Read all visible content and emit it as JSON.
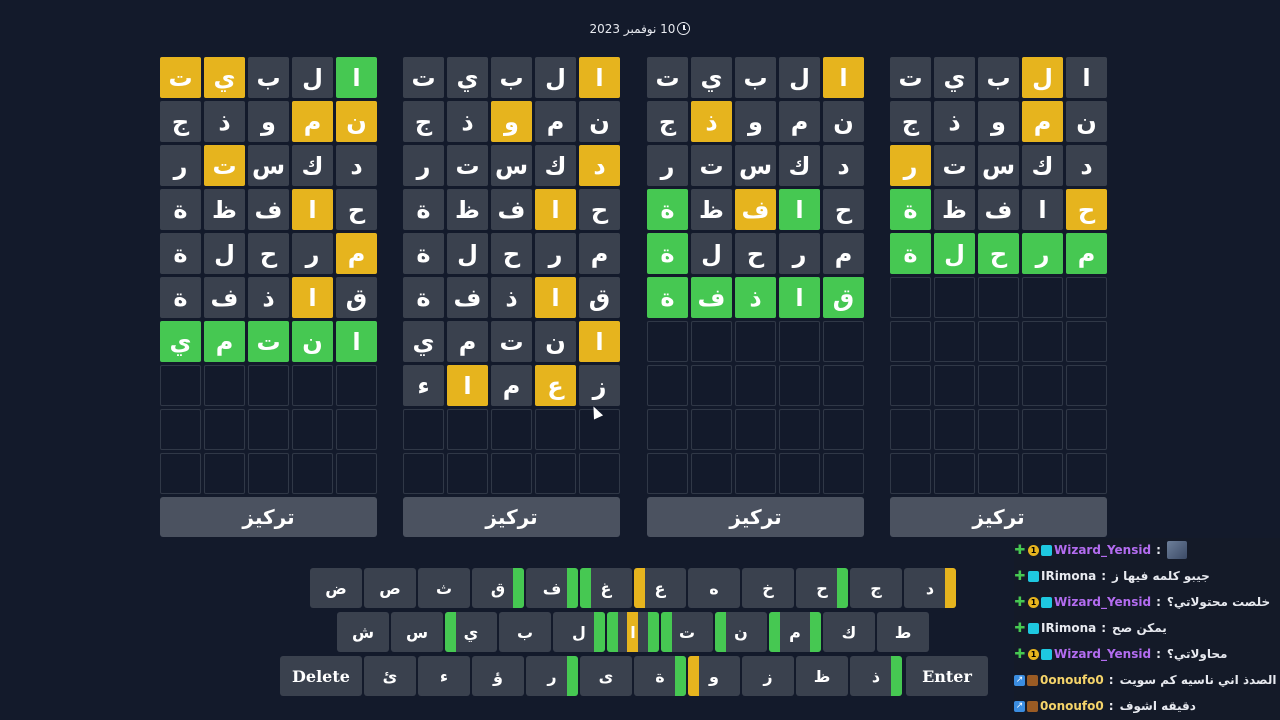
{
  "header": {
    "date": "10 نوفمبر 2023"
  },
  "boards": [
    {
      "focus_label": "تركيز",
      "rows": [
        [
          [
            "ت",
            "y"
          ],
          [
            "ي",
            "y"
          ],
          [
            "ب",
            "n"
          ],
          [
            "ل",
            "n"
          ],
          [
            "ا",
            "g"
          ]
        ],
        [
          [
            "ج",
            "n"
          ],
          [
            "ذ",
            "n"
          ],
          [
            "و",
            "n"
          ],
          [
            "م",
            "y"
          ],
          [
            "ن",
            "y"
          ]
        ],
        [
          [
            "ر",
            "n"
          ],
          [
            "ت",
            "y"
          ],
          [
            "س",
            "n"
          ],
          [
            "ك",
            "n"
          ],
          [
            "د",
            "n"
          ]
        ],
        [
          [
            "ة",
            "n"
          ],
          [
            "ظ",
            "n"
          ],
          [
            "ف",
            "n"
          ],
          [
            "ا",
            "y"
          ],
          [
            "ح",
            "n"
          ]
        ],
        [
          [
            "ة",
            "n"
          ],
          [
            "ل",
            "n"
          ],
          [
            "ح",
            "n"
          ],
          [
            "ر",
            "n"
          ],
          [
            "م",
            "y"
          ]
        ],
        [
          [
            "ة",
            "n"
          ],
          [
            "ف",
            "n"
          ],
          [
            "ذ",
            "n"
          ],
          [
            "ا",
            "y"
          ],
          [
            "ق",
            "n"
          ]
        ],
        [
          [
            "ي",
            "g"
          ],
          [
            "م",
            "g"
          ],
          [
            "ت",
            "g"
          ],
          [
            "ن",
            "g"
          ],
          [
            "ا",
            "g"
          ]
        ],
        [
          [
            "",
            "e"
          ],
          [
            "",
            "e"
          ],
          [
            "",
            "e"
          ],
          [
            "",
            "e"
          ],
          [
            "",
            "e"
          ]
        ],
        [
          [
            "",
            "e"
          ],
          [
            "",
            "e"
          ],
          [
            "",
            "e"
          ],
          [
            "",
            "e"
          ],
          [
            "",
            "e"
          ]
        ],
        [
          [
            "",
            "e"
          ],
          [
            "",
            "e"
          ],
          [
            "",
            "e"
          ],
          [
            "",
            "e"
          ],
          [
            "",
            "e"
          ]
        ]
      ]
    },
    {
      "focus_label": "تركيز",
      "rows": [
        [
          [
            "ت",
            "n"
          ],
          [
            "ي",
            "n"
          ],
          [
            "ب",
            "n"
          ],
          [
            "ل",
            "n"
          ],
          [
            "ا",
            "y"
          ]
        ],
        [
          [
            "ج",
            "n"
          ],
          [
            "ذ",
            "n"
          ],
          [
            "و",
            "y"
          ],
          [
            "م",
            "n"
          ],
          [
            "ن",
            "n"
          ]
        ],
        [
          [
            "ر",
            "n"
          ],
          [
            "ت",
            "n"
          ],
          [
            "س",
            "n"
          ],
          [
            "ك",
            "n"
          ],
          [
            "د",
            "y"
          ]
        ],
        [
          [
            "ة",
            "n"
          ],
          [
            "ظ",
            "n"
          ],
          [
            "ف",
            "n"
          ],
          [
            "ا",
            "y"
          ],
          [
            "ح",
            "n"
          ]
        ],
        [
          [
            "ة",
            "n"
          ],
          [
            "ل",
            "n"
          ],
          [
            "ح",
            "n"
          ],
          [
            "ر",
            "n"
          ],
          [
            "م",
            "n"
          ]
        ],
        [
          [
            "ة",
            "n"
          ],
          [
            "ف",
            "n"
          ],
          [
            "ذ",
            "n"
          ],
          [
            "ا",
            "y"
          ],
          [
            "ق",
            "n"
          ]
        ],
        [
          [
            "ي",
            "n"
          ],
          [
            "م",
            "n"
          ],
          [
            "ت",
            "n"
          ],
          [
            "ن",
            "n"
          ],
          [
            "ا",
            "y"
          ]
        ],
        [
          [
            "ء",
            "n"
          ],
          [
            "ا",
            "y"
          ],
          [
            "م",
            "n"
          ],
          [
            "ع",
            "y"
          ],
          [
            "ز",
            "n"
          ]
        ],
        [
          [
            "",
            "e"
          ],
          [
            "",
            "e"
          ],
          [
            "",
            "e"
          ],
          [
            "",
            "e"
          ],
          [
            "",
            "e"
          ]
        ],
        [
          [
            "",
            "e"
          ],
          [
            "",
            "e"
          ],
          [
            "",
            "e"
          ],
          [
            "",
            "e"
          ],
          [
            "",
            "e"
          ]
        ]
      ]
    },
    {
      "focus_label": "تركيز",
      "rows": [
        [
          [
            "ت",
            "n"
          ],
          [
            "ي",
            "n"
          ],
          [
            "ب",
            "n"
          ],
          [
            "ل",
            "n"
          ],
          [
            "ا",
            "y"
          ]
        ],
        [
          [
            "ج",
            "n"
          ],
          [
            "ذ",
            "y"
          ],
          [
            "و",
            "n"
          ],
          [
            "م",
            "n"
          ],
          [
            "ن",
            "n"
          ]
        ],
        [
          [
            "ر",
            "n"
          ],
          [
            "ت",
            "n"
          ],
          [
            "س",
            "n"
          ],
          [
            "ك",
            "n"
          ],
          [
            "د",
            "n"
          ]
        ],
        [
          [
            "ة",
            "g"
          ],
          [
            "ظ",
            "n"
          ],
          [
            "ف",
            "y"
          ],
          [
            "ا",
            "g"
          ],
          [
            "ح",
            "n"
          ]
        ],
        [
          [
            "ة",
            "g"
          ],
          [
            "ل",
            "n"
          ],
          [
            "ح",
            "n"
          ],
          [
            "ر",
            "n"
          ],
          [
            "م",
            "n"
          ]
        ],
        [
          [
            "ة",
            "g"
          ],
          [
            "ف",
            "g"
          ],
          [
            "ذ",
            "g"
          ],
          [
            "ا",
            "g"
          ],
          [
            "ق",
            "g"
          ]
        ],
        [
          [
            "",
            "e"
          ],
          [
            "",
            "e"
          ],
          [
            "",
            "e"
          ],
          [
            "",
            "e"
          ],
          [
            "",
            "e"
          ]
        ],
        [
          [
            "",
            "e"
          ],
          [
            "",
            "e"
          ],
          [
            "",
            "e"
          ],
          [
            "",
            "e"
          ],
          [
            "",
            "e"
          ]
        ],
        [
          [
            "",
            "e"
          ],
          [
            "",
            "e"
          ],
          [
            "",
            "e"
          ],
          [
            "",
            "e"
          ],
          [
            "",
            "e"
          ]
        ],
        [
          [
            "",
            "e"
          ],
          [
            "",
            "e"
          ],
          [
            "",
            "e"
          ],
          [
            "",
            "e"
          ],
          [
            "",
            "e"
          ]
        ]
      ]
    },
    {
      "focus_label": "تركيز",
      "rows": [
        [
          [
            "ت",
            "n"
          ],
          [
            "ي",
            "n"
          ],
          [
            "ب",
            "n"
          ],
          [
            "ل",
            "y"
          ],
          [
            "ا",
            "n"
          ]
        ],
        [
          [
            "ج",
            "n"
          ],
          [
            "ذ",
            "n"
          ],
          [
            "و",
            "n"
          ],
          [
            "م",
            "y"
          ],
          [
            "ن",
            "n"
          ]
        ],
        [
          [
            "ر",
            "y"
          ],
          [
            "ت",
            "n"
          ],
          [
            "س",
            "n"
          ],
          [
            "ك",
            "n"
          ],
          [
            "د",
            "n"
          ]
        ],
        [
          [
            "ة",
            "g"
          ],
          [
            "ظ",
            "n"
          ],
          [
            "ف",
            "n"
          ],
          [
            "ا",
            "n"
          ],
          [
            "ح",
            "y"
          ]
        ],
        [
          [
            "ة",
            "g"
          ],
          [
            "ل",
            "g"
          ],
          [
            "ح",
            "g"
          ],
          [
            "ر",
            "g"
          ],
          [
            "م",
            "g"
          ]
        ],
        [
          [
            "",
            "e"
          ],
          [
            "",
            "e"
          ],
          [
            "",
            "e"
          ],
          [
            "",
            "e"
          ],
          [
            "",
            "e"
          ]
        ],
        [
          [
            "",
            "e"
          ],
          [
            "",
            "e"
          ],
          [
            "",
            "e"
          ],
          [
            "",
            "e"
          ],
          [
            "",
            "e"
          ]
        ],
        [
          [
            "",
            "e"
          ],
          [
            "",
            "e"
          ],
          [
            "",
            "e"
          ],
          [
            "",
            "e"
          ],
          [
            "",
            "e"
          ]
        ],
        [
          [
            "",
            "e"
          ],
          [
            "",
            "e"
          ],
          [
            "",
            "e"
          ],
          [
            "",
            "e"
          ],
          [
            "",
            "e"
          ]
        ],
        [
          [
            "",
            "e"
          ],
          [
            "",
            "e"
          ],
          [
            "",
            "e"
          ],
          [
            "",
            "e"
          ],
          [
            "",
            "e"
          ]
        ]
      ]
    }
  ],
  "keyboard": {
    "rows": [
      [
        {
          "k": "ض"
        },
        {
          "k": "ص"
        },
        {
          "k": "ث"
        },
        {
          "k": "ق",
          "bars": [
            [
              "right",
              "g"
            ]
          ]
        },
        {
          "k": "ف",
          "bars": [
            [
              "right",
              "g"
            ]
          ]
        },
        {
          "k": "غ",
          "bars": [
            [
              "left",
              "g"
            ]
          ]
        },
        {
          "k": "ع",
          "bars": [
            [
              "left",
              "y"
            ]
          ]
        },
        {
          "k": "ه"
        },
        {
          "k": "خ"
        },
        {
          "k": "ح",
          "bars": [
            [
              "right",
              "g"
            ]
          ]
        },
        {
          "k": "ج"
        },
        {
          "k": "د",
          "bars": [
            [
              "right",
              "y"
            ]
          ]
        }
      ],
      [
        {
          "k": "ش"
        },
        {
          "k": "س"
        },
        {
          "k": "ي",
          "bars": [
            [
              "left",
              "g"
            ]
          ]
        },
        {
          "k": "ب"
        },
        {
          "k": "ل",
          "bars": [
            [
              "right",
              "g"
            ]
          ]
        },
        {
          "k": "ا",
          "bars": [
            [
              "left",
              "g"
            ],
            [
              "mid",
              "y"
            ],
            [
              "right",
              "g"
            ]
          ]
        },
        {
          "k": "ت",
          "bars": [
            [
              "left",
              "g"
            ]
          ]
        },
        {
          "k": "ن",
          "bars": [
            [
              "left",
              "g"
            ]
          ]
        },
        {
          "k": "م",
          "bars": [
            [
              "left",
              "g"
            ],
            [
              "right",
              "g"
            ]
          ]
        },
        {
          "k": "ك"
        },
        {
          "k": "ط"
        }
      ],
      [
        {
          "k": "Delete",
          "wide": true
        },
        {
          "k": "ئ"
        },
        {
          "k": "ء"
        },
        {
          "k": "ؤ"
        },
        {
          "k": "ر",
          "bars": [
            [
              "right",
              "g"
            ]
          ]
        },
        {
          "k": "ى"
        },
        {
          "k": "ة",
          "bars": [
            [
              "right",
              "g"
            ]
          ]
        },
        {
          "k": "و",
          "bars": [
            [
              "left",
              "y"
            ]
          ]
        },
        {
          "k": "ز"
        },
        {
          "k": "ظ"
        },
        {
          "k": "ذ",
          "bars": [
            [
              "right",
              "g"
            ]
          ]
        },
        {
          "k": "Enter",
          "wide": true
        }
      ]
    ]
  },
  "chat": {
    "messages": [
      {
        "user": "Wizard_Yensid",
        "color": "#b36cf0",
        "badges": [
          "plus",
          "one",
          "vip"
        ],
        "text": "",
        "avatar": true
      },
      {
        "user": "IRimona",
        "color": "#e8eaf0",
        "badges": [
          "plus",
          "vip"
        ],
        "text": "جيبو كلمه فيها ز"
      },
      {
        "user": "Wizard_Yensid",
        "color": "#b36cf0",
        "badges": [
          "plus",
          "one",
          "vip"
        ],
        "text": "خلصت محتولاتي؟"
      },
      {
        "user": "IRimona",
        "color": "#e8eaf0",
        "badges": [
          "plus",
          "vip"
        ],
        "text": "يمكن صح"
      },
      {
        "user": "Wizard_Yensid",
        "color": "#b36cf0",
        "badges": [
          "plus",
          "one",
          "vip"
        ],
        "text": "محاولاتي؟"
      },
      {
        "user": "0onoufo0",
        "color": "#f5d46a",
        "badges": [
          "arrow",
          "game"
        ],
        "text": "الصدذ اني ناسيه كم سويت"
      },
      {
        "user": "0onoufo0",
        "color": "#f5d46a",
        "badges": [
          "arrow",
          "game"
        ],
        "text": "دقيقه اشوف"
      }
    ]
  }
}
